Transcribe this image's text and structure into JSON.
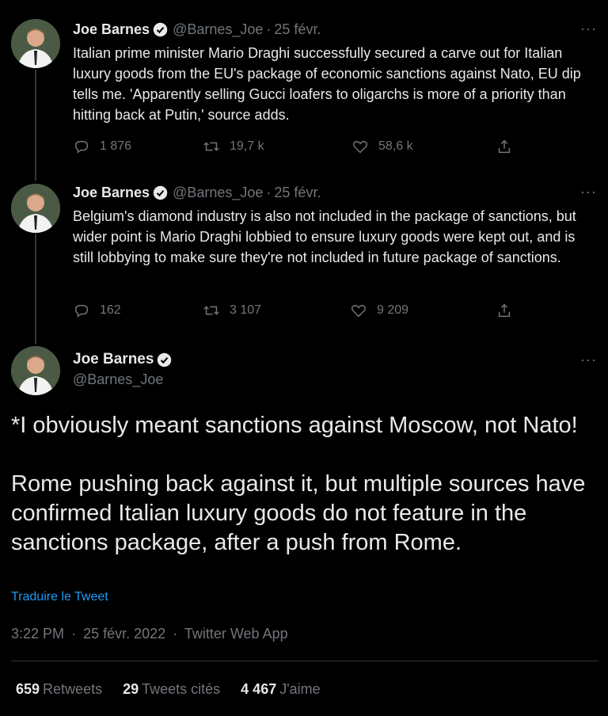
{
  "tweets": [
    {
      "name": "Joe Barnes",
      "handle": "@Barnes_Joe",
      "sep": "·",
      "date": "25 févr.",
      "text": "Italian prime minister Mario Draghi successfully secured a carve out for Italian luxury goods from the EU's package of economic sanctions against Nato, EU dip tells me. 'Apparently selling Gucci loafers to oligarchs is more of a priority than hitting back at Putin,' source adds.",
      "replies": "1 876",
      "retweets": "19,7 k",
      "likes": "58,6 k"
    },
    {
      "name": "Joe Barnes",
      "handle": "@Barnes_Joe",
      "sep": "·",
      "date": "25 févr.",
      "text": "Belgium's diamond industry is also not included in the package of sanctions, but wider point is Mario Draghi lobbied to ensure luxury goods were kept out, and is still lobbying to make sure they're not included in future package of sanctions.",
      "replies": "162",
      "retweets": "3 107",
      "likes": "9 209"
    }
  ],
  "main": {
    "name": "Joe Barnes",
    "handle": "@Barnes_Joe",
    "para1": "*I obviously meant sanctions against Moscow, not Nato!",
    "para2": "Rome pushing back against it, but multiple sources have confirmed Italian luxury goods do not feature in the sanctions package, after a push from Rome.",
    "translate": "Traduire le Tweet",
    "time": "3:22 PM",
    "date": "25 févr. 2022",
    "sep": "·",
    "app": "Twitter Web App",
    "stats": {
      "retweets_count": "659",
      "retweets_label": "Retweets",
      "quotes_count": "29",
      "quotes_label": "Tweets cités",
      "likes_count": "4 467",
      "likes_label": "J'aime"
    }
  },
  "more_label": "···",
  "colors": {
    "background": "#000000",
    "text": "#e7e9ea",
    "secondary": "#71767b",
    "accent": "#1d9bf0"
  },
  "icons": [
    "verified-badge-icon",
    "reply-icon",
    "retweet-icon",
    "like-icon",
    "share-icon",
    "more-icon"
  ]
}
